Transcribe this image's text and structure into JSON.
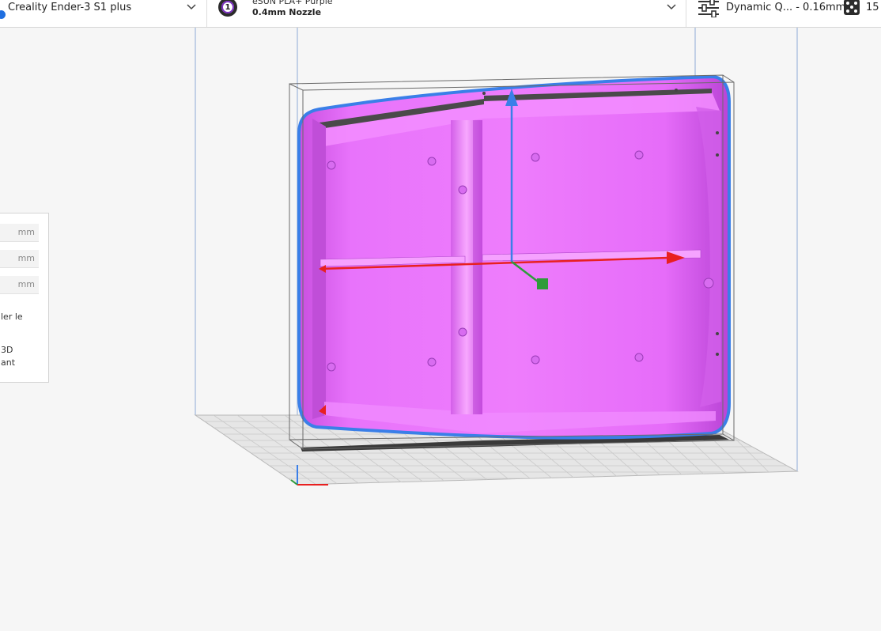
{
  "header": {
    "printer_name": "Creality Ender-3 S1 plus",
    "extruder_number": "1",
    "material_name": "eSUN PLA+ Purple",
    "nozzle_name": "0.4mm Nozzle",
    "profile_label": "Dynamic Q... - 0.16mm",
    "support_label": "15"
  },
  "scale_panel": {
    "unit_x": "mm",
    "unit_y": "mm",
    "unit_z": "mm",
    "text_line_1": "ler le",
    "text_line_2": "3D",
    "text_line_3": "ant"
  },
  "colors": {
    "model_fill": "#e56bfa",
    "model_outline": "#3a7fe8",
    "axis_x": "#e82020",
    "axis_y": "#2e9b3a",
    "axis_z": "#3a7fe8",
    "build_plate": "#e4e4e4",
    "accent_blue": "#1f6fe0"
  }
}
